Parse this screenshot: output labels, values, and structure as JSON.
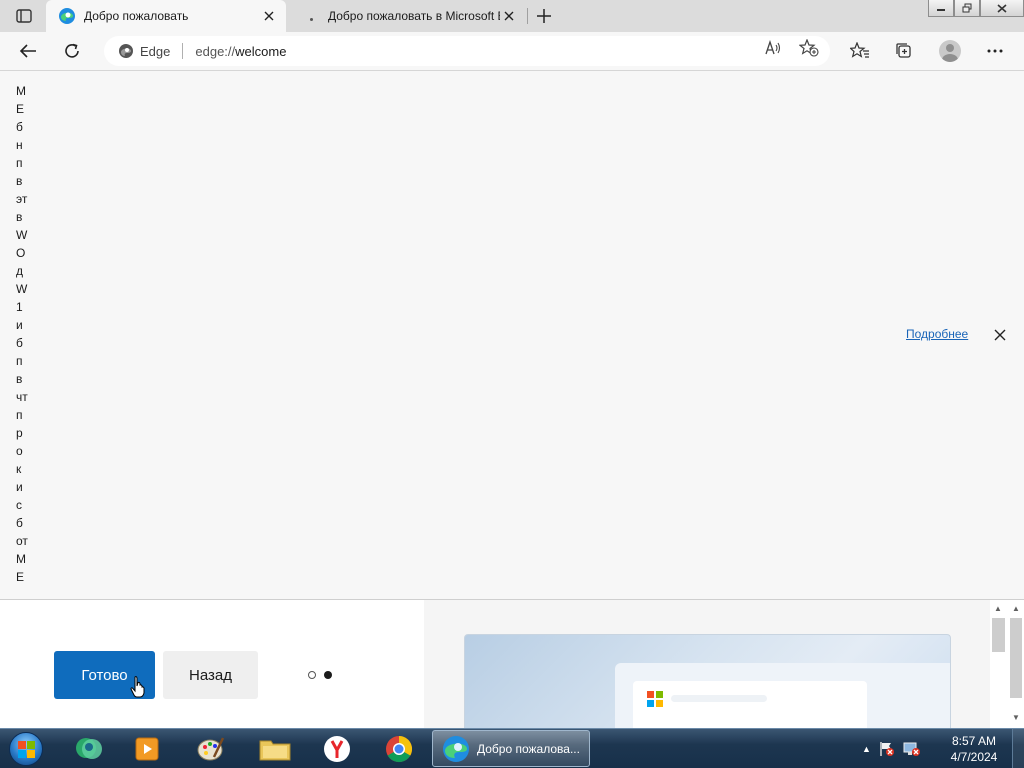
{
  "tabs": [
    {
      "title": "Добро пожаловать",
      "active": true
    },
    {
      "title": "Добро пожаловать в Microsoft Edge",
      "active": false
    }
  ],
  "address_bar": {
    "site_label": "Edge",
    "url_scheme": "edge://",
    "url_host": "welcome"
  },
  "vertical_text": [
    "М",
    "Е",
    "б",
    "н",
    "п",
    "в",
    "эт",
    "в",
    "W",
    "О",
    "д",
    "W",
    "1",
    "и",
    "б",
    "п",
    "в",
    "чт",
    "п",
    "р",
    "о",
    "к",
    "и",
    "с",
    "б",
    "от",
    "М",
    "Е"
  ],
  "banner": {
    "more_link": "Подробнее"
  },
  "onboarding": {
    "done_label": "Готово",
    "back_label": "Назад",
    "pager_total": 2,
    "pager_current": 2
  },
  "taskbar": {
    "active_window_label": "Добро пожалова...",
    "clock_time": "8:57 AM",
    "clock_date": "4/7/2024"
  },
  "colors": {
    "accent": "#0f6cbd",
    "link": "#1a65b8"
  }
}
